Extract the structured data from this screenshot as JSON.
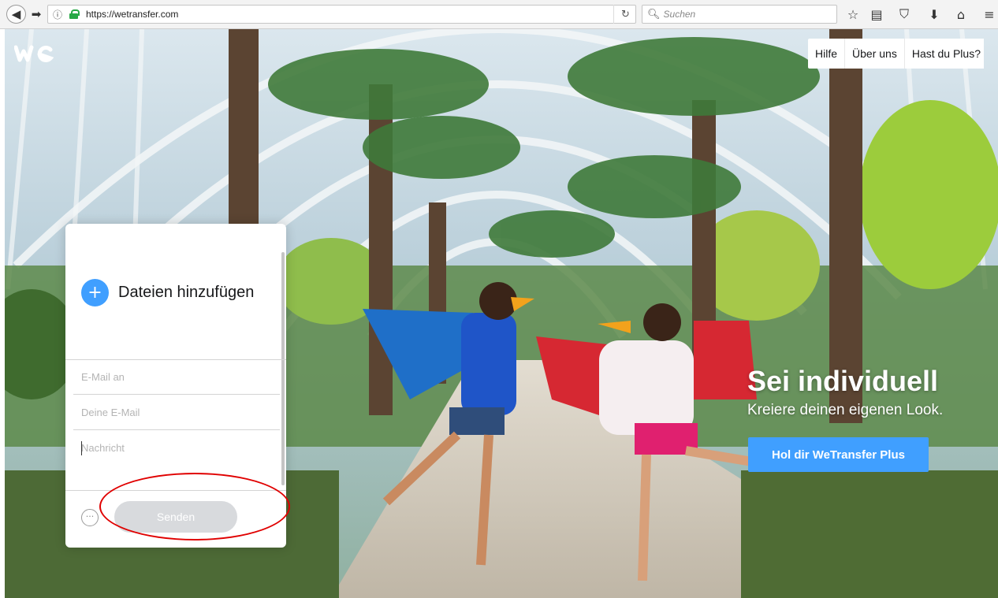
{
  "browser": {
    "url": "https://wetransfer.com",
    "search_placeholder": "Suchen"
  },
  "header": {
    "logo_alt": "we",
    "nav": [
      "Hilfe",
      "Über uns",
      "Hast du Plus?"
    ]
  },
  "upload_panel": {
    "add_files_label": "Dateien hinzufügen",
    "email_to_placeholder": "E-Mail an",
    "own_email_placeholder": "Deine E-Mail",
    "message_placeholder": "Nachricht",
    "send_label": "Senden",
    "more_options_label": "···"
  },
  "promo": {
    "title": "Sei individuell",
    "subtitle": "Kreiere deinen eigenen Look.",
    "cta": "Hol dir WeTransfer Plus"
  },
  "colors": {
    "accent": "#409fff",
    "send_disabled": "#d8dadd",
    "highlight": "#e00000",
    "lock_green": "#27a845"
  },
  "icons": {
    "back": "back-arrow-icon",
    "forward": "forward-arrow-icon",
    "info": "info-icon",
    "lock": "lock-icon",
    "reload": "reload-icon",
    "search": "search-icon",
    "bookmark_star": "star-icon",
    "reading_list": "reader-icon",
    "pocket": "pocket-icon",
    "downloads": "download-icon",
    "home": "home-icon",
    "menu": "hamburger-menu-icon",
    "add": "plus-icon"
  }
}
